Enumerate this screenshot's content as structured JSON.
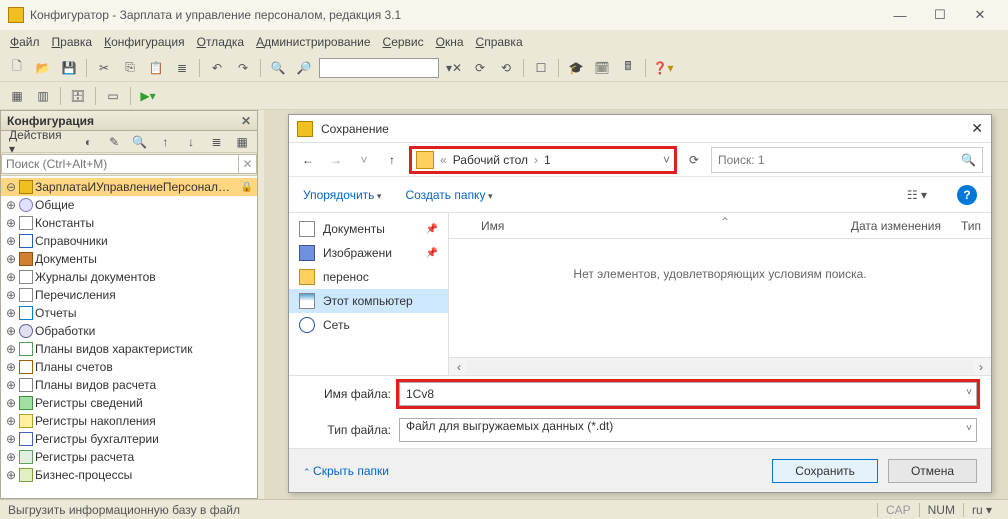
{
  "window": {
    "title": "Конфигуратор - Зарплата и управление персоналом, редакция 3.1"
  },
  "menu": [
    "Файл",
    "Правка",
    "Конфигурация",
    "Отладка",
    "Администрирование",
    "Сервис",
    "Окна",
    "Справка"
  ],
  "config_panel": {
    "title": "Конфигурация",
    "actions": "Действия",
    "search_placeholder": "Поиск (Ctrl+Alt+M)",
    "tree": [
      {
        "label": "ЗарплатаИУправлениеПерсонал…",
        "icon": "ico-cube",
        "sel": true,
        "lock": true
      },
      {
        "label": "Общие",
        "icon": "ico-gear"
      },
      {
        "label": "Константы",
        "icon": "ico-box"
      },
      {
        "label": "Справочники",
        "icon": "ico-doc"
      },
      {
        "label": "Документы",
        "icon": "ico-book"
      },
      {
        "label": "Журналы документов",
        "icon": "ico-bars"
      },
      {
        "label": "Перечисления",
        "icon": "ico-bars"
      },
      {
        "label": "Отчеты",
        "icon": "ico-sheet"
      },
      {
        "label": "Обработки",
        "icon": "ico-cog"
      },
      {
        "label": "Планы видов характеристик",
        "icon": "ico-grid"
      },
      {
        "label": "Планы счетов",
        "icon": "ico-t"
      },
      {
        "label": "Планы видов расчета",
        "icon": "ico-calc"
      },
      {
        "label": "Регистры сведений",
        "icon": "ico-green"
      },
      {
        "label": "Регистры накопления",
        "icon": "ico-dollar"
      },
      {
        "label": "Регистры бухгалтерии",
        "icon": "ico-blue"
      },
      {
        "label": "Регистры расчета",
        "icon": "ico-px"
      },
      {
        "label": "Бизнес-процессы",
        "icon": "ico-arrow"
      }
    ]
  },
  "dialog": {
    "title": "Сохранение",
    "path": {
      "seg1": "Рабочий стол",
      "seg2": "1"
    },
    "search_placeholder": "Поиск: 1",
    "organize": "Упорядочить",
    "new_folder": "Создать папку",
    "nav": [
      {
        "label": "Документы",
        "icon": "ni-doc",
        "pin": true
      },
      {
        "label": "Изображени",
        "icon": "ni-img",
        "pin": true
      },
      {
        "label": "перенос",
        "icon": "ni-fold"
      },
      {
        "label": "Этот компьютер",
        "icon": "ni-pc",
        "sel": true
      },
      {
        "label": "Сеть",
        "icon": "ni-net"
      }
    ],
    "columns": {
      "name": "Имя",
      "date": "Дата изменения",
      "type": "Тип"
    },
    "empty_text": "Нет элементов, удовлетворяющих условиям поиска.",
    "filename_label": "Имя файла:",
    "filename_value": "1Cv8",
    "filetype_label": "Тип файла:",
    "filetype_value": "Файл для выгружаемых данных (*.dt)",
    "hide_folders": "Скрыть папки",
    "save": "Сохранить",
    "cancel": "Отмена"
  },
  "status": {
    "text": "Выгрузить информационную базу в файл",
    "cap": "CAP",
    "num": "NUM",
    "lang": "ru"
  }
}
